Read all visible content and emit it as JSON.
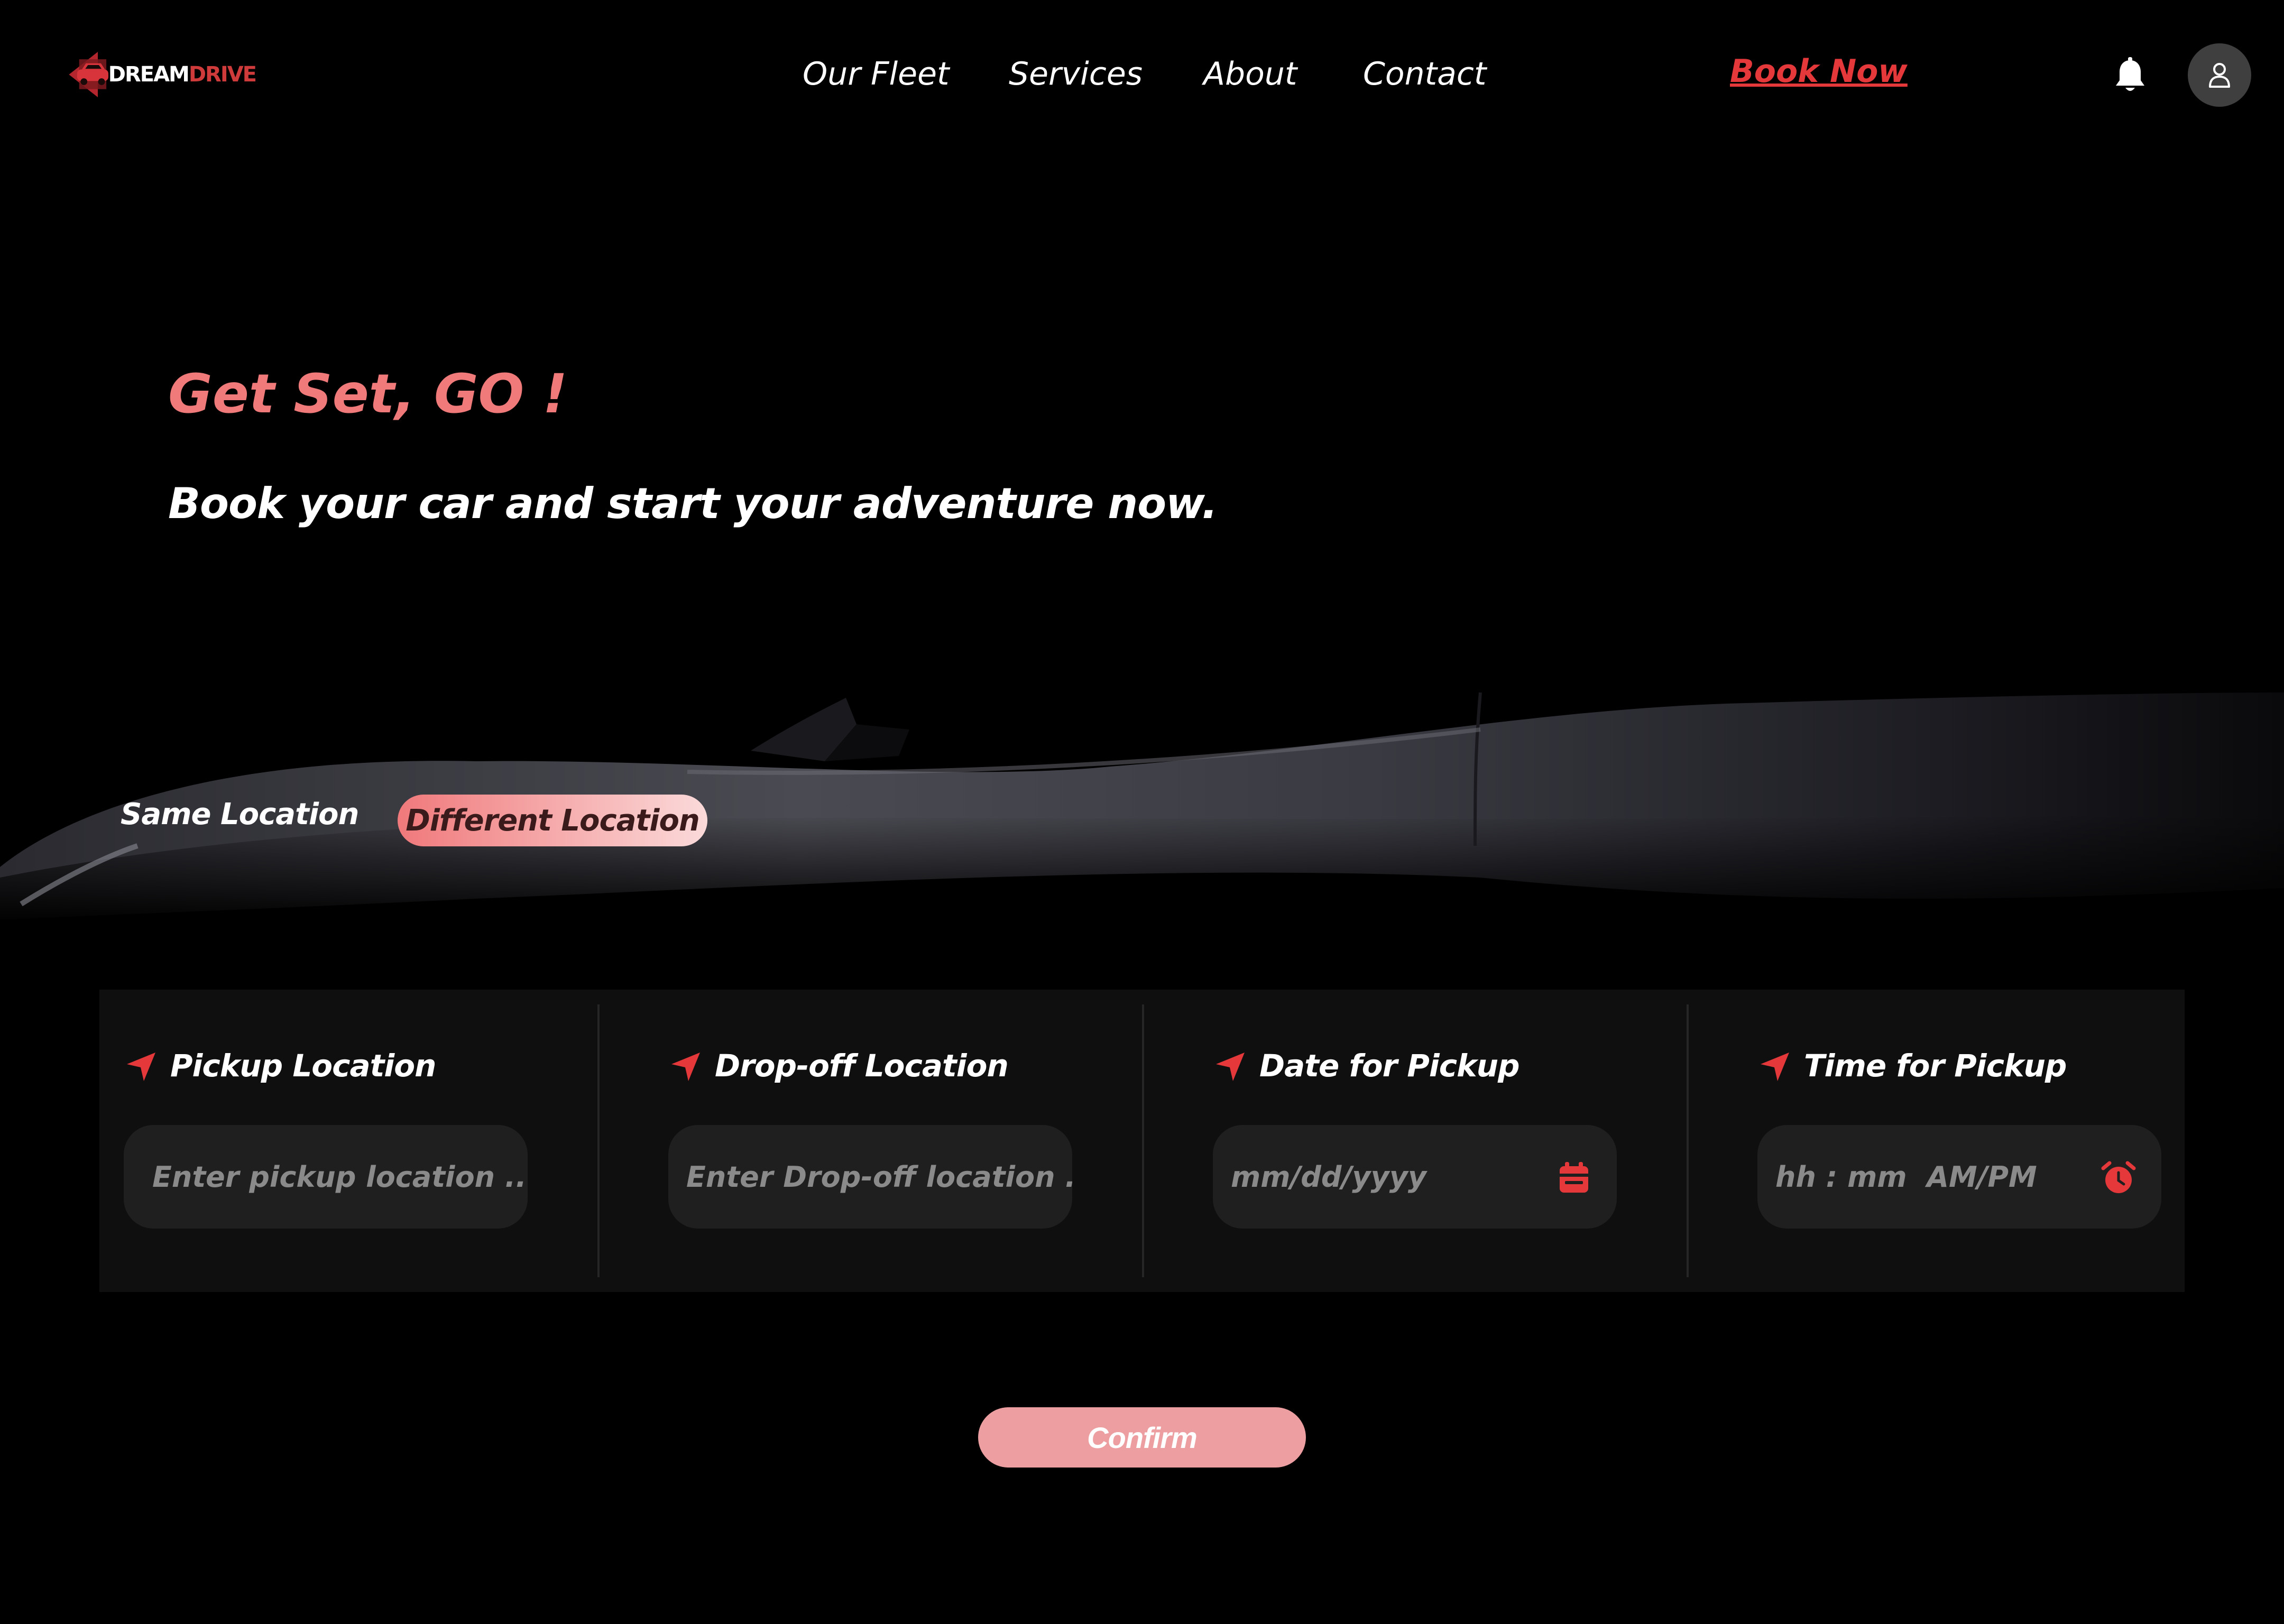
{
  "brand": {
    "name_part1": "DREAM",
    "name_part2": "DRIVE"
  },
  "nav": {
    "items": [
      {
        "label": "Our Fleet"
      },
      {
        "label": "Services"
      },
      {
        "label": "About"
      },
      {
        "label": "Contact"
      }
    ],
    "book_now": "Book Now"
  },
  "header_icons": {
    "notification": "bell-icon",
    "profile": "user-icon"
  },
  "hero": {
    "title": "Get Set, GO !",
    "subtitle": "Book your car and start your adventure now."
  },
  "location_toggle": {
    "options": [
      "Same Location",
      "Different Location"
    ],
    "selected": "Different Location"
  },
  "booking": {
    "fields": [
      {
        "label": "Pickup Location",
        "placeholder": "Enter pickup location ...",
        "icon": "navigation-arrow-icon"
      },
      {
        "label": "Drop-off Location",
        "placeholder": "Enter Drop-off location ...",
        "icon": "navigation-arrow-icon"
      },
      {
        "label": "Date for Pickup",
        "placeholder": "mm/dd/yyyy",
        "icon": "navigation-arrow-icon",
        "input_icon": "calendar-icon"
      },
      {
        "label": "Time for Pickup",
        "placeholder": "hh : mm  AM/PM",
        "icon": "navigation-arrow-icon",
        "input_icon": "alarm-clock-icon"
      }
    ],
    "confirm_label": "Confirm"
  },
  "colors": {
    "background": "#000000",
    "accent_red": "#e5383b",
    "hero_title": "#f07a7a",
    "panel": "#0f0f0f",
    "input_bg": "#1f1f1f",
    "confirm_bg": "#ec9ea0"
  }
}
